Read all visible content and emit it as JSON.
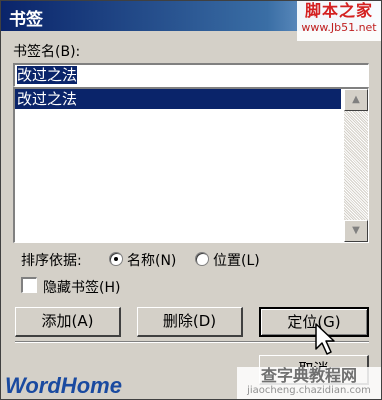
{
  "window": {
    "title": "书签"
  },
  "watermark_top": {
    "brand": "脚本之家",
    "url": "www.Jb51.net"
  },
  "bookmark_name": {
    "label": "书签名(B):",
    "value": "改过之法"
  },
  "bookmark_list": {
    "items": [
      "改过之法"
    ],
    "selected_index": 0
  },
  "sort_by": {
    "label": "排序依据:",
    "options": [
      {
        "label": "名称(N)",
        "selected": true
      },
      {
        "label": "位置(L)",
        "selected": false
      }
    ]
  },
  "hidden_bookmarks": {
    "label": "隐藏书签(H)",
    "checked": false
  },
  "buttons": {
    "add": "添加(A)",
    "delete": "删除(D)",
    "goto": "定位(G)",
    "cancel": "取消"
  },
  "watermark_bottom_left": {
    "text": "WordHome"
  },
  "watermark_bottom_right": {
    "text": "查字典教程网",
    "url": "jiaocheng.chazidian.com"
  },
  "colors": {
    "dialog_bg": "#d4d0c8",
    "title_bar": "#0a246a",
    "selection": "#0a246a"
  }
}
